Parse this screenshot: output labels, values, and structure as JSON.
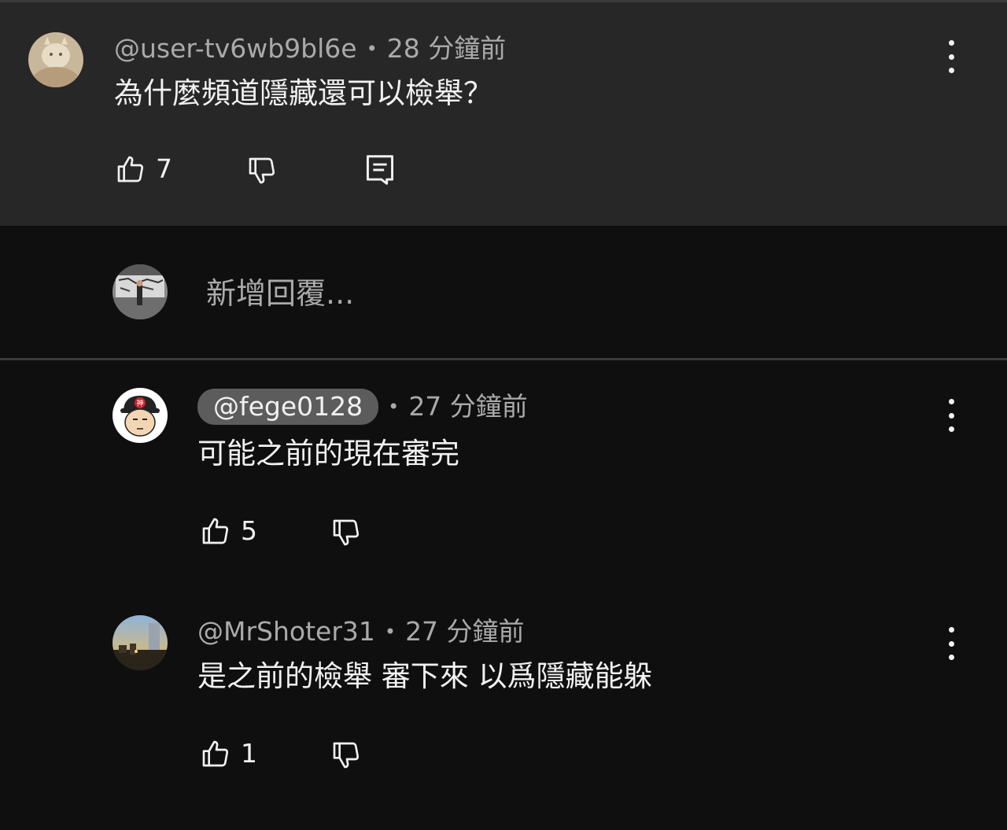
{
  "comments": {
    "parent": {
      "handle": "@user-tv6wb9bl6e",
      "time": "28 分鐘前",
      "text": "為什麼頻道隱藏還可以檢舉？",
      "likes": "7"
    },
    "reply_box": {
      "placeholder": "新增回覆..."
    },
    "replies": [
      {
        "handle": "@fege0128",
        "time": "27 分鐘前",
        "text": "可能之前的現在審完",
        "likes": "5",
        "handle_highlighted": true
      },
      {
        "handle": "@MrShoter31",
        "time": "27 分鐘前",
        "text": "是之前的檢舉 審下來 以爲隱藏能躲",
        "likes": "1",
        "handle_highlighted": false
      }
    ]
  },
  "separator": "•",
  "icons": {
    "like": "thumb-up-icon",
    "dislike": "thumb-down-icon",
    "reply": "comment-reply-icon",
    "more": "more-vert-icon"
  },
  "colors": {
    "background": "#0f0f0f",
    "highlight_background": "#272727",
    "chip": "#5c5c5c",
    "secondary_text": "#aaaaaa"
  }
}
